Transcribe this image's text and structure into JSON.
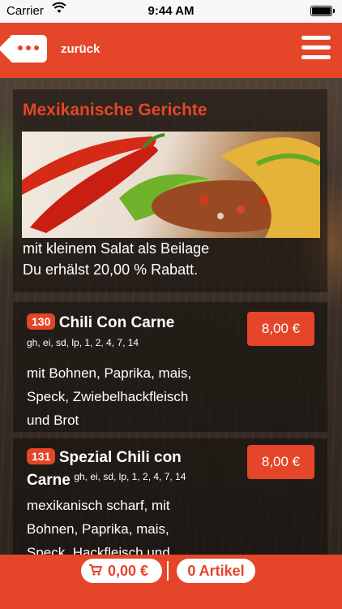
{
  "status_bar": {
    "carrier": "Carrier",
    "time": "9:44 AM"
  },
  "header": {
    "back_label": "zurück"
  },
  "category": {
    "title": "Mexikanische Gerichte",
    "info_lines": [
      "mit kleinem Salat als Beilage",
      "Du erhälst 20,00 % Rabatt."
    ]
  },
  "items": [
    {
      "number": "130",
      "name": "Chili Con Carne",
      "allergens": "gh, ei, sd, lp, 1, 2, 4, 7, 14",
      "description_lines": [
        "mit Bohnen, Paprika, mais,",
        "Speck, Zwiebelhackfleisch",
        "und Brot"
      ],
      "price": "8,00 €"
    },
    {
      "number": "131",
      "name_line1": "Spezial Chili con",
      "name_line2": "Carne",
      "allergens": "gh, ei, sd, lp, 1, 2, 4, 7, 14",
      "description_lines": [
        "mexikanisch scharf, mit",
        "Bohnen, Paprika, mais,",
        "Speck, Hackfleisch und"
      ],
      "price": "8,00 €"
    }
  ],
  "footer": {
    "cart_total": "0,00 €",
    "article_count": "0 Artikel"
  },
  "colors": {
    "accent": "#e54529"
  },
  "icons": [
    "wifi-icon",
    "battery-icon",
    "back-icon",
    "menu-icon",
    "cart-icon"
  ]
}
